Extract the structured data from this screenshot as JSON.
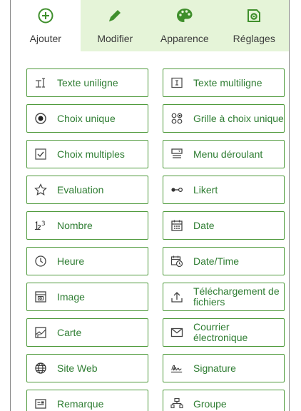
{
  "colors": {
    "accent": "#3f8f2c",
    "tab_bg": "#e5f4d8",
    "border": "#4f9a3c",
    "label": "#2e7d32"
  },
  "tabs": [
    {
      "label": "Ajouter",
      "icon": "plus-circle-icon",
      "active": true
    },
    {
      "label": "Modifier",
      "icon": "pencil-icon",
      "active": false
    },
    {
      "label": "Apparence",
      "icon": "palette-icon",
      "active": false
    },
    {
      "label": "Réglages",
      "icon": "settings-icon",
      "active": false
    }
  ],
  "questions": [
    {
      "label": "Texte uniligne",
      "icon": "single-line-text-icon"
    },
    {
      "label": "Texte multiligne",
      "icon": "multiline-text-icon"
    },
    {
      "label": "Choix unique",
      "icon": "radio-icon"
    },
    {
      "label": "Grille à choix unique",
      "icon": "grid-choice-icon"
    },
    {
      "label": "Choix multiples",
      "icon": "checkbox-icon"
    },
    {
      "label": "Menu déroulant",
      "icon": "dropdown-icon"
    },
    {
      "label": "Evaluation",
      "icon": "star-icon"
    },
    {
      "label": "Likert",
      "icon": "likert-icon"
    },
    {
      "label": "Nombre",
      "icon": "number-icon"
    },
    {
      "label": "Date",
      "icon": "calendar-icon"
    },
    {
      "label": "Heure",
      "icon": "clock-icon"
    },
    {
      "label": "Date/Time",
      "icon": "datetime-icon"
    },
    {
      "label": "Image",
      "icon": "image-icon"
    },
    {
      "label": "Téléchargement de fichiers",
      "icon": "upload-icon"
    },
    {
      "label": "Carte",
      "icon": "map-icon"
    },
    {
      "label": "Courrier électronique",
      "icon": "email-icon"
    },
    {
      "label": "Site Web",
      "icon": "globe-icon"
    },
    {
      "label": "Signature",
      "icon": "signature-icon"
    },
    {
      "label": "Remarque",
      "icon": "note-icon"
    },
    {
      "label": "Groupe",
      "icon": "group-icon"
    }
  ]
}
